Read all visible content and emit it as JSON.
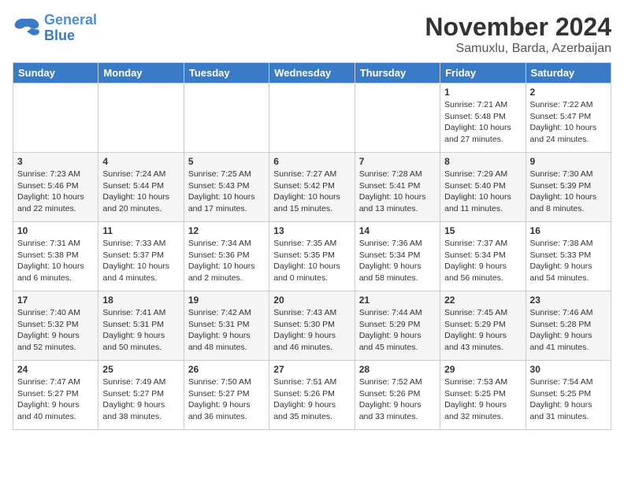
{
  "header": {
    "logo_line1": "General",
    "logo_line2": "Blue",
    "month": "November 2024",
    "location": "Samuxlu, Barda, Azerbaijan"
  },
  "weekdays": [
    "Sunday",
    "Monday",
    "Tuesday",
    "Wednesday",
    "Thursday",
    "Friday",
    "Saturday"
  ],
  "weeks": [
    [
      {
        "day": "",
        "info": ""
      },
      {
        "day": "",
        "info": ""
      },
      {
        "day": "",
        "info": ""
      },
      {
        "day": "",
        "info": ""
      },
      {
        "day": "",
        "info": ""
      },
      {
        "day": "1",
        "info": "Sunrise: 7:21 AM\nSunset: 5:48 PM\nDaylight: 10 hours and 27 minutes."
      },
      {
        "day": "2",
        "info": "Sunrise: 7:22 AM\nSunset: 5:47 PM\nDaylight: 10 hours and 24 minutes."
      }
    ],
    [
      {
        "day": "3",
        "info": "Sunrise: 7:23 AM\nSunset: 5:46 PM\nDaylight: 10 hours and 22 minutes."
      },
      {
        "day": "4",
        "info": "Sunrise: 7:24 AM\nSunset: 5:44 PM\nDaylight: 10 hours and 20 minutes."
      },
      {
        "day": "5",
        "info": "Sunrise: 7:25 AM\nSunset: 5:43 PM\nDaylight: 10 hours and 17 minutes."
      },
      {
        "day": "6",
        "info": "Sunrise: 7:27 AM\nSunset: 5:42 PM\nDaylight: 10 hours and 15 minutes."
      },
      {
        "day": "7",
        "info": "Sunrise: 7:28 AM\nSunset: 5:41 PM\nDaylight: 10 hours and 13 minutes."
      },
      {
        "day": "8",
        "info": "Sunrise: 7:29 AM\nSunset: 5:40 PM\nDaylight: 10 hours and 11 minutes."
      },
      {
        "day": "9",
        "info": "Sunrise: 7:30 AM\nSunset: 5:39 PM\nDaylight: 10 hours and 8 minutes."
      }
    ],
    [
      {
        "day": "10",
        "info": "Sunrise: 7:31 AM\nSunset: 5:38 PM\nDaylight: 10 hours and 6 minutes."
      },
      {
        "day": "11",
        "info": "Sunrise: 7:33 AM\nSunset: 5:37 PM\nDaylight: 10 hours and 4 minutes."
      },
      {
        "day": "12",
        "info": "Sunrise: 7:34 AM\nSunset: 5:36 PM\nDaylight: 10 hours and 2 minutes."
      },
      {
        "day": "13",
        "info": "Sunrise: 7:35 AM\nSunset: 5:35 PM\nDaylight: 10 hours and 0 minutes."
      },
      {
        "day": "14",
        "info": "Sunrise: 7:36 AM\nSunset: 5:34 PM\nDaylight: 9 hours and 58 minutes."
      },
      {
        "day": "15",
        "info": "Sunrise: 7:37 AM\nSunset: 5:34 PM\nDaylight: 9 hours and 56 minutes."
      },
      {
        "day": "16",
        "info": "Sunrise: 7:38 AM\nSunset: 5:33 PM\nDaylight: 9 hours and 54 minutes."
      }
    ],
    [
      {
        "day": "17",
        "info": "Sunrise: 7:40 AM\nSunset: 5:32 PM\nDaylight: 9 hours and 52 minutes."
      },
      {
        "day": "18",
        "info": "Sunrise: 7:41 AM\nSunset: 5:31 PM\nDaylight: 9 hours and 50 minutes."
      },
      {
        "day": "19",
        "info": "Sunrise: 7:42 AM\nSunset: 5:31 PM\nDaylight: 9 hours and 48 minutes."
      },
      {
        "day": "20",
        "info": "Sunrise: 7:43 AM\nSunset: 5:30 PM\nDaylight: 9 hours and 46 minutes."
      },
      {
        "day": "21",
        "info": "Sunrise: 7:44 AM\nSunset: 5:29 PM\nDaylight: 9 hours and 45 minutes."
      },
      {
        "day": "22",
        "info": "Sunrise: 7:45 AM\nSunset: 5:29 PM\nDaylight: 9 hours and 43 minutes."
      },
      {
        "day": "23",
        "info": "Sunrise: 7:46 AM\nSunset: 5:28 PM\nDaylight: 9 hours and 41 minutes."
      }
    ],
    [
      {
        "day": "24",
        "info": "Sunrise: 7:47 AM\nSunset: 5:27 PM\nDaylight: 9 hours and 40 minutes."
      },
      {
        "day": "25",
        "info": "Sunrise: 7:49 AM\nSunset: 5:27 PM\nDaylight: 9 hours and 38 minutes."
      },
      {
        "day": "26",
        "info": "Sunrise: 7:50 AM\nSunset: 5:27 PM\nDaylight: 9 hours and 36 minutes."
      },
      {
        "day": "27",
        "info": "Sunrise: 7:51 AM\nSunset: 5:26 PM\nDaylight: 9 hours and 35 minutes."
      },
      {
        "day": "28",
        "info": "Sunrise: 7:52 AM\nSunset: 5:26 PM\nDaylight: 9 hours and 33 minutes."
      },
      {
        "day": "29",
        "info": "Sunrise: 7:53 AM\nSunset: 5:25 PM\nDaylight: 9 hours and 32 minutes."
      },
      {
        "day": "30",
        "info": "Sunrise: 7:54 AM\nSunset: 5:25 PM\nDaylight: 9 hours and 31 minutes."
      }
    ]
  ]
}
